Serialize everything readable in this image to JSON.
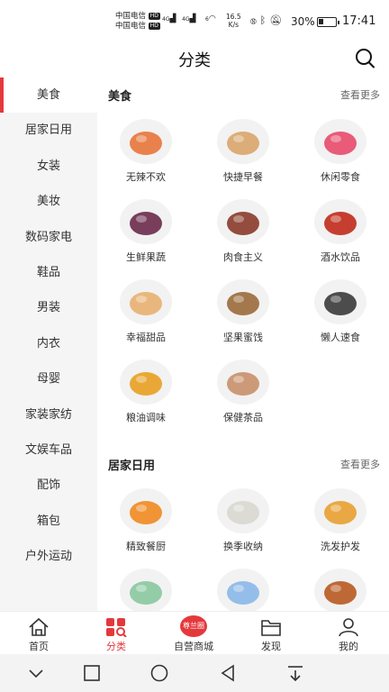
{
  "status_bar": {
    "carrier1": "中国电信",
    "carrier2": "中国电信",
    "hd": "HD",
    "net1": "4G",
    "net2": "4G",
    "wifi_label": "6",
    "speed_value": "16.5",
    "speed_unit": "K/s",
    "battery_percent": "30%",
    "battery_level": 0.3,
    "time": "17:41"
  },
  "header": {
    "title": "分类",
    "search_icon": "search-icon"
  },
  "sidebar": {
    "items": [
      {
        "label": "美食"
      },
      {
        "label": "居家日用"
      },
      {
        "label": "女装"
      },
      {
        "label": "美妆"
      },
      {
        "label": "数码家电"
      },
      {
        "label": "鞋品"
      },
      {
        "label": "男装"
      },
      {
        "label": "内衣"
      },
      {
        "label": "母婴"
      },
      {
        "label": "家装家纺"
      },
      {
        "label": "文娱车品"
      },
      {
        "label": "配饰"
      },
      {
        "label": "箱包"
      },
      {
        "label": "户外运动"
      }
    ]
  },
  "sections": [
    {
      "title": "美食",
      "more": "查看更多",
      "items": [
        {
          "label": "无辣不欢",
          "color": "#e8743b"
        },
        {
          "label": "快捷早餐",
          "color": "#d9a56a"
        },
        {
          "label": "休闲零食",
          "color": "#e84a6a"
        },
        {
          "label": "生鲜果蔬",
          "color": "#6a2a4a"
        },
        {
          "label": "肉食主义",
          "color": "#8a3a2a"
        },
        {
          "label": "酒水饮品",
          "color": "#c02a1a"
        },
        {
          "label": "幸福甜品",
          "color": "#e8b070"
        },
        {
          "label": "坚果蜜饯",
          "color": "#9a6a3a"
        },
        {
          "label": "懒人速食",
          "color": "#3a3a3a"
        },
        {
          "label": "粮油调味",
          "color": "#e8a020"
        },
        {
          "label": "保健茶品",
          "color": "#c8906a"
        }
      ]
    },
    {
      "title": "居家日用",
      "more": "查看更多",
      "items": [
        {
          "label": "精致餐厨",
          "color": "#f08a20"
        },
        {
          "label": "换季收纳",
          "color": "#d8d8d0"
        },
        {
          "label": "洗发护发",
          "color": "#e8a030"
        },
        {
          "label": "",
          "color": "#8ac8a0"
        },
        {
          "label": "",
          "color": "#8ab8e8"
        },
        {
          "label": "",
          "color": "#b85a20"
        }
      ]
    }
  ],
  "tabbar": {
    "tabs": [
      {
        "label": "首页"
      },
      {
        "label": "分类"
      },
      {
        "label": "自营商城"
      },
      {
        "label": "发现"
      },
      {
        "label": "我的"
      }
    ],
    "mall_badge": "尊兰圈",
    "accent": "#e4393c"
  }
}
